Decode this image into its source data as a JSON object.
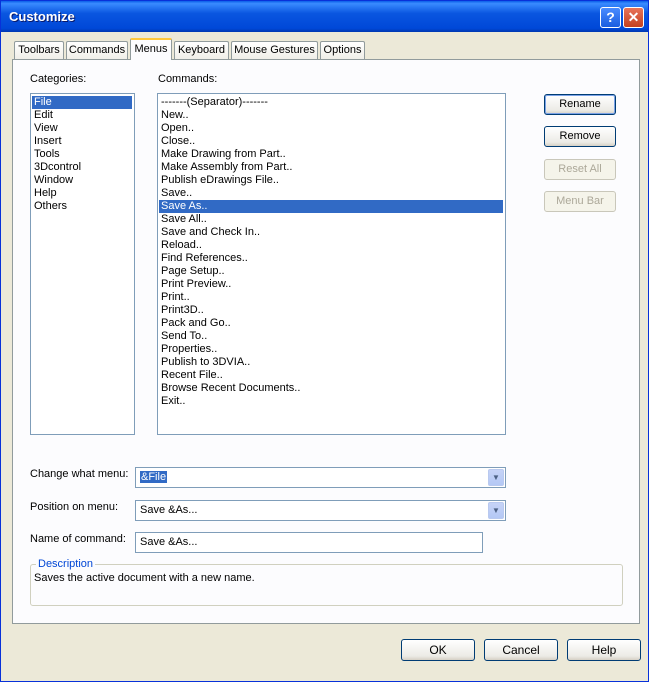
{
  "window": {
    "title": "Customize"
  },
  "titlebar": {
    "help_glyph": "?",
    "close_glyph": "✕"
  },
  "tabs": [
    {
      "label": "Toolbars"
    },
    {
      "label": "Commands"
    },
    {
      "label": "Menus"
    },
    {
      "label": "Keyboard"
    },
    {
      "label": "Mouse Gestures"
    },
    {
      "label": "Options"
    }
  ],
  "active_tab": "Menus",
  "categories": {
    "label": "Categories:",
    "items": [
      "File",
      "Edit",
      "View",
      "Insert",
      "Tools",
      "3Dcontrol",
      "Window",
      "Help",
      "Others"
    ],
    "selected": "File"
  },
  "commands": {
    "label": "Commands:",
    "items": [
      "-------(Separator)-------",
      "New..",
      "Open..",
      "Close..",
      "Make Drawing from Part..",
      "Make Assembly from Part..",
      "Publish eDrawings File..",
      "Save..",
      "Save As..",
      "Save All..",
      "Save and Check In..",
      "Reload..",
      "Find References..",
      "Page Setup..",
      "Print Preview..",
      "Print..",
      "Print3D..",
      "Pack and Go..",
      "Send To..",
      "Properties..",
      "Publish to 3DVIA..",
      "Recent File..",
      "Browse Recent Documents..",
      "Exit.."
    ],
    "selected": "Save As.."
  },
  "side_buttons": {
    "rename": "Rename",
    "remove": "Remove",
    "reset_all": "Reset All",
    "menu_bar": "Menu Bar"
  },
  "form": {
    "change_menu_label": "Change what menu:",
    "change_menu_value": "&File",
    "position_label": "Position on menu:",
    "position_value": "Save &As...",
    "name_label": "Name of command:",
    "name_value": "Save &As..."
  },
  "description": {
    "legend": "Description",
    "text": "Saves the active document with a new name."
  },
  "footer": {
    "ok": "OK",
    "cancel": "Cancel",
    "help": "Help"
  },
  "colors": {
    "accent": "#316ac5",
    "titlebar": "#0a56e0",
    "tab_highlight": "#ffc83c"
  }
}
